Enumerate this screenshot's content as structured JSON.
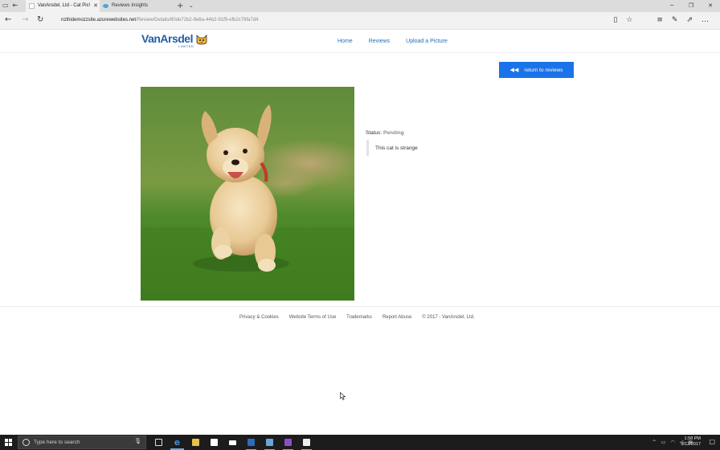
{
  "browser": {
    "tabs": [
      {
        "title": "VanArsdel, Ltd - Cat Pic!",
        "active": true
      },
      {
        "title": "Reviews Insights",
        "active": false
      }
    ],
    "url_host": "nzthidemozzsite.azurewebsites.net",
    "url_path": "/Review/Details/80de72b2-9e6a-44b2-91f9-efb2c78fa7d4"
  },
  "site": {
    "logo_text": "VanArsdel",
    "logo_sub": "LIMITED",
    "nav": [
      "Home",
      "Reviews",
      "Upload a Picture"
    ]
  },
  "review": {
    "return_label": "return to reviews",
    "status_label": "Status:",
    "status_value": "Pending",
    "comment": "This cat is strange"
  },
  "footer": {
    "links": [
      "Privacy & Cookies",
      "Website Terms of Use",
      "Trademarks",
      "Report Abuse"
    ],
    "copyright": "© 2017 - VanArsdel, Ltd."
  },
  "taskbar": {
    "search_placeholder": "Type here to search",
    "time": "1:58 PM",
    "date": "5/12/2017"
  },
  "colors": {
    "accent": "#1a73e8",
    "link": "#1f6fb8",
    "logo": "#1f5fa6",
    "status_pending": "#8a8a8a"
  }
}
